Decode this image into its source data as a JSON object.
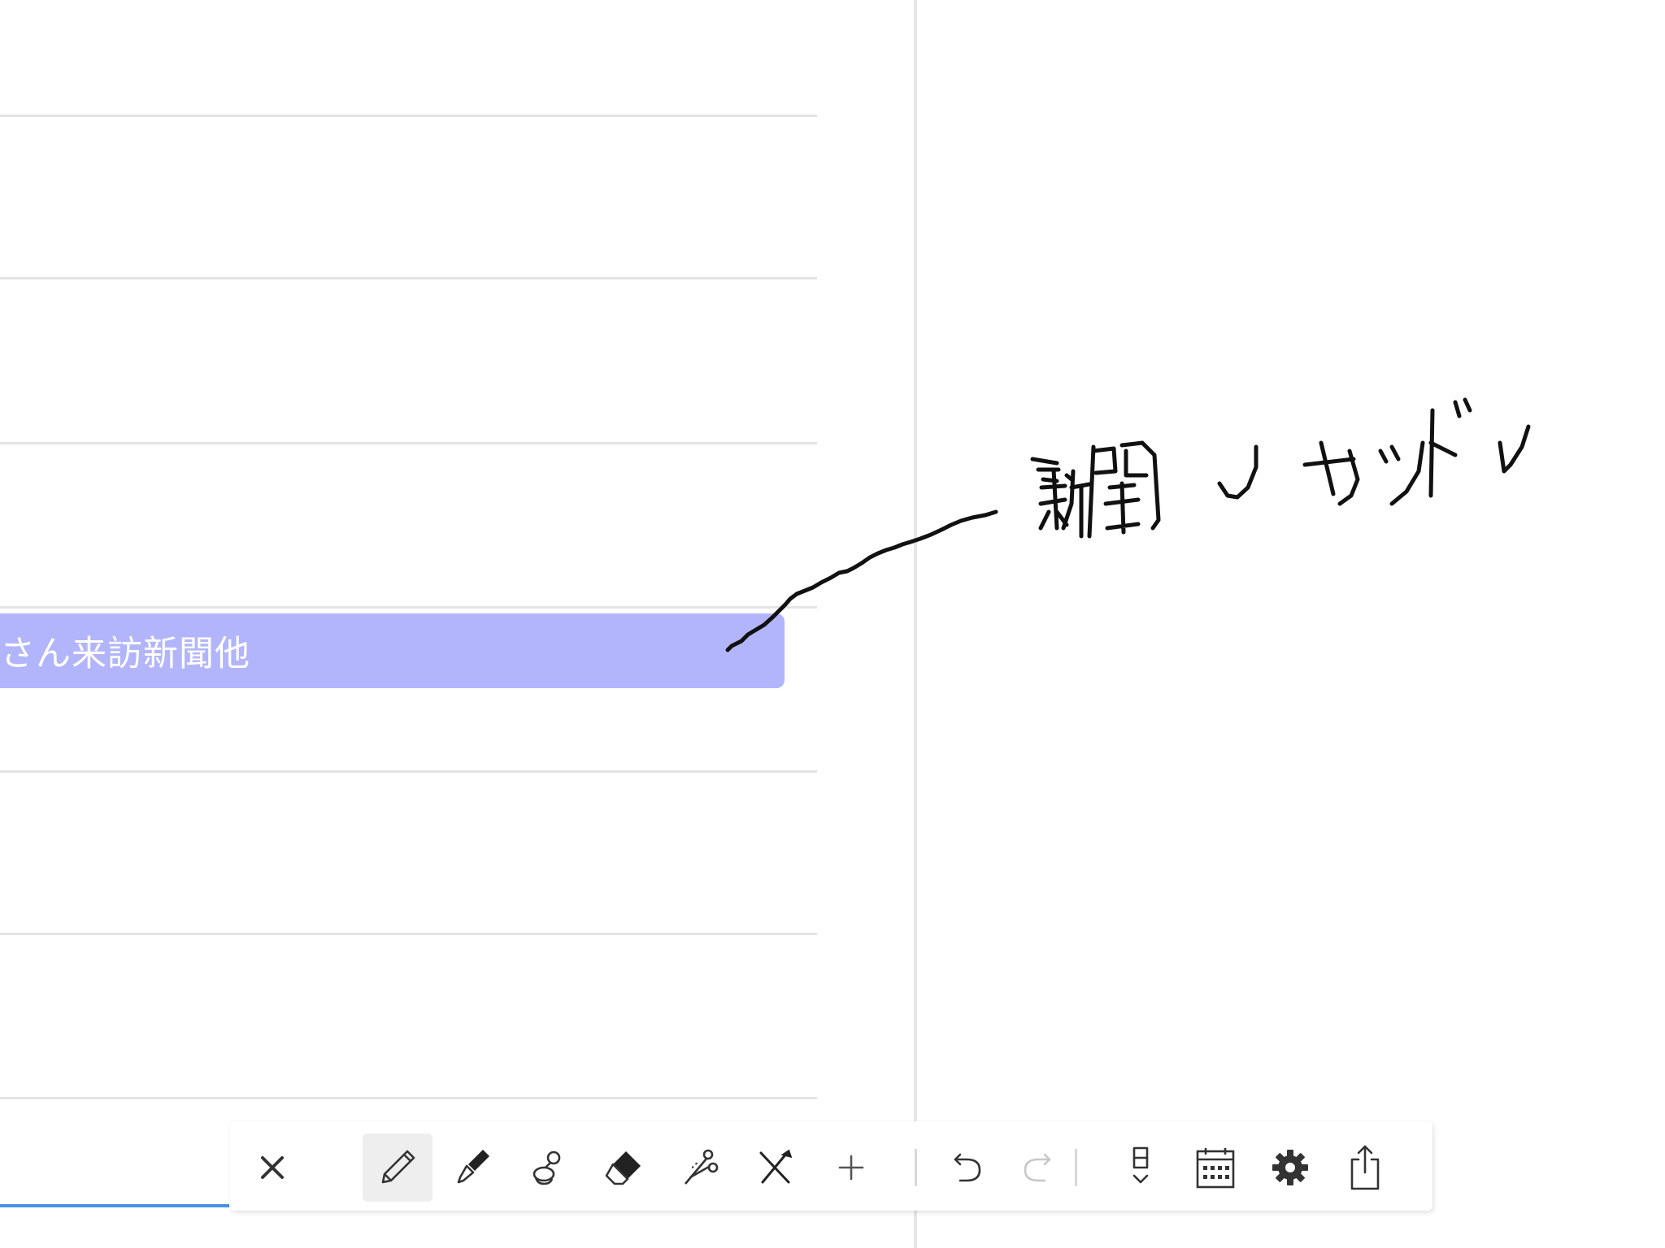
{
  "calendar": {
    "event_label": "さん来訪新聞他",
    "event_color": "#b3b5fc"
  },
  "handwriting": {
    "text": "新聞✓ サンド✓",
    "ink_color": "#111111"
  },
  "toolbar": {
    "items": [
      {
        "name": "close",
        "icon": "close-icon",
        "active": false
      },
      {
        "name": "pencil",
        "icon": "pencil-icon",
        "active": true
      },
      {
        "name": "pen",
        "icon": "pen-icon",
        "active": false
      },
      {
        "name": "stamp",
        "icon": "stamp-icon",
        "active": false
      },
      {
        "name": "eraser",
        "icon": "eraser-icon",
        "active": false
      },
      {
        "name": "scissors",
        "icon": "scissors-icon",
        "active": false
      },
      {
        "name": "tools",
        "icon": "crossed-tools-icon",
        "active": false
      },
      {
        "name": "add",
        "icon": "plus-icon",
        "active": false
      },
      {
        "name": "undo",
        "icon": "undo-icon",
        "active": false
      },
      {
        "name": "redo",
        "icon": "redo-icon",
        "active": false,
        "disabled": true
      },
      {
        "name": "day-view",
        "icon": "day-view-icon",
        "active": false
      },
      {
        "name": "calendar",
        "icon": "calendar-icon",
        "active": false
      },
      {
        "name": "settings",
        "icon": "gear-icon",
        "active": false
      },
      {
        "name": "share",
        "icon": "share-icon",
        "active": false
      }
    ]
  },
  "colors": {
    "accent_blue": "#4a90e2",
    "icon": "#333333",
    "icon_disabled": "#c8c8c8"
  }
}
